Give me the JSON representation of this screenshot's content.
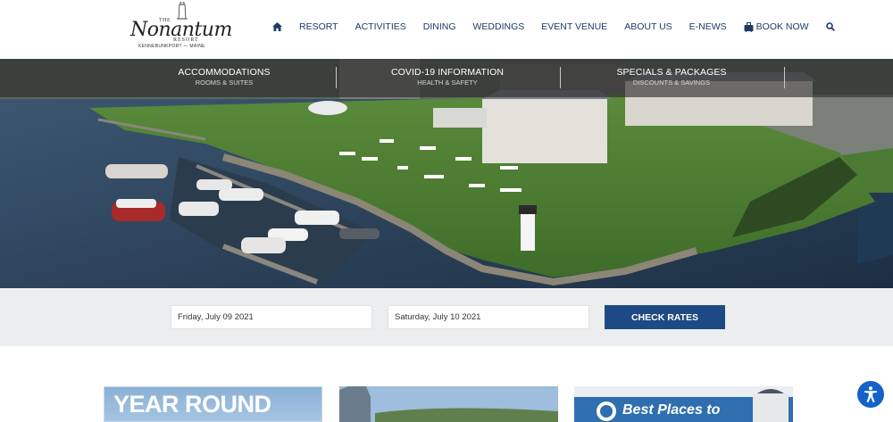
{
  "logo": {
    "the": "THE",
    "name": "Nonantum",
    "resort": "RESORT",
    "location": "KENNEBUNKPORT — MAINE"
  },
  "nav": {
    "home_icon": "home-icon",
    "items": [
      {
        "label": "RESORT"
      },
      {
        "label": "ACTIVITIES"
      },
      {
        "label": "DINING"
      },
      {
        "label": "WEDDINGS"
      },
      {
        "label": "EVENT VENUE"
      },
      {
        "label": "ABOUT US"
      },
      {
        "label": "E-NEWS"
      }
    ],
    "book_now": "BOOK NOW",
    "book_icon": "luggage-icon",
    "search_icon": "search-icon"
  },
  "promos": [
    {
      "title": "ACCOMMODATIONS",
      "subtitle": "ROOMS & SUITES"
    },
    {
      "title": "COVID-19 INFORMATION",
      "subtitle": "HEALTH & SAFETY"
    },
    {
      "title": "SPECIALS & PACKAGES",
      "subtitle": "DISCOUNTS & SAVINGS"
    }
  ],
  "booking": {
    "checkin": "Friday, July 09 2021",
    "checkout": "Saturday, July 10 2021",
    "button": "CHECK RATES"
  },
  "cards": [
    {
      "text": "YEAR ROUND"
    },
    {
      "text": ""
    },
    {
      "text": "Best Places to"
    }
  ],
  "accessibility_icon": "accessibility-icon",
  "colors": {
    "nav_text": "#1e3a64",
    "button": "#1d4a84",
    "booking_bg": "#ecedee",
    "accessibility": "#1462c9"
  }
}
